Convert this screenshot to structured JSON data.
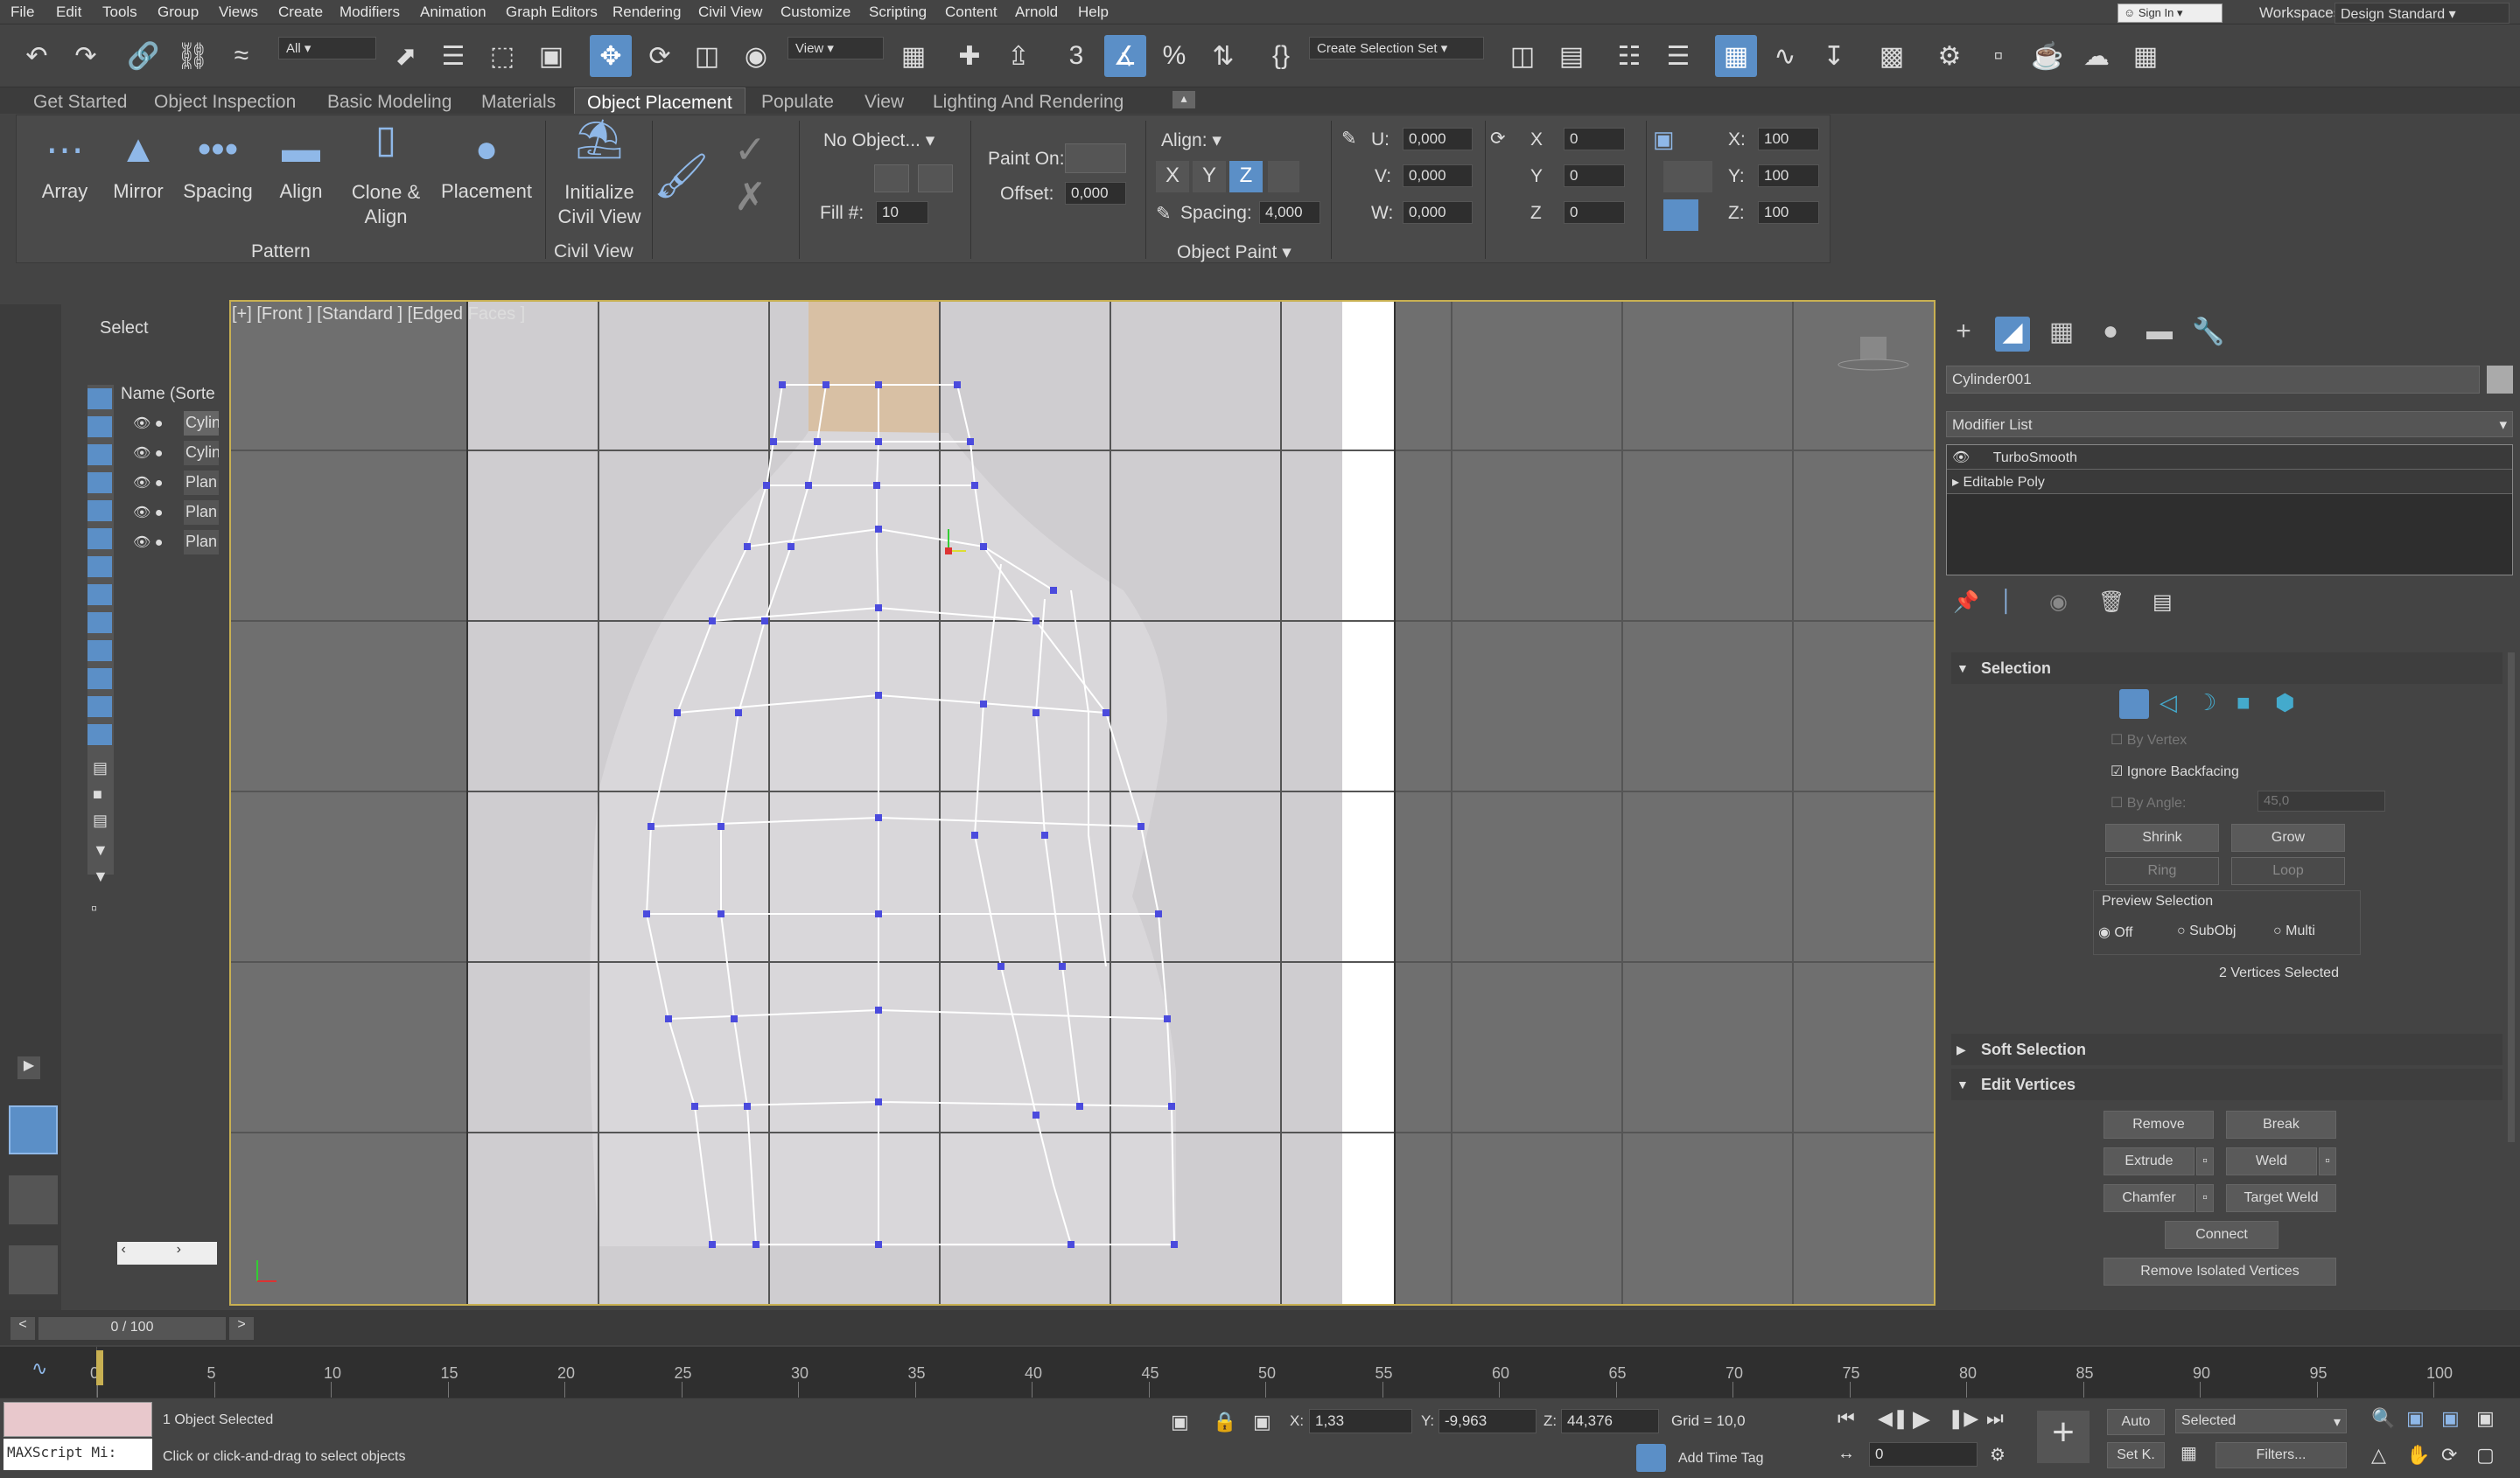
{
  "menu": [
    "File",
    "Edit",
    "Tools",
    "Group",
    "Views",
    "Create",
    "Modifiers",
    "Animation",
    "Graph Editors",
    "Rendering",
    "Civil View",
    "Customize",
    "Scripting",
    "Content",
    "Arnold",
    "Help"
  ],
  "signin": "Sign In",
  "workspaces_label": "Workspaces:",
  "workspace": "Design Standard",
  "toolbar": {
    "filter": "All",
    "ref_coord": "View",
    "selset": "Create Selection Set"
  },
  "tabs": [
    "Get Started",
    "Object Inspection",
    "Basic Modeling",
    "Materials",
    "Object Placement",
    "Populate",
    "View",
    "Lighting And Rendering"
  ],
  "ribbon": {
    "pattern_buttons": [
      "Array",
      "Mirror",
      "Spacing",
      "Align",
      "Clone &\nAlign",
      "Placement"
    ],
    "pattern_label": "Pattern",
    "civil_button": "Initialize\nCivil View",
    "civil_label": "Civil View",
    "no_object": "No Object...",
    "fill_label": "Fill #:",
    "fill_value": "10",
    "paint_on": "Paint On:",
    "offset_label": "Offset:",
    "offset_value": "0,000",
    "align_label": "Align:",
    "spacing_label": "Spacing:",
    "spacing_value": "4,000",
    "axes": [
      "X",
      "Y",
      "Z"
    ],
    "u_label": "U:",
    "u_value": "0,000",
    "v_label": "V:",
    "v_value": "0,000",
    "w_label": "W:",
    "w_value": "0,000",
    "rx_label": "X",
    "rx_value": "0",
    "ry_label": "Y",
    "ry_value": "0",
    "rz_label": "Z",
    "rz_value": "0",
    "sx_label": "X:",
    "sx_value": "100",
    "sy_label": "Y:",
    "sy_value": "100",
    "sz_label": "Z:",
    "sz_value": "100",
    "object_paint_label": "Object Paint"
  },
  "scene": {
    "select": "Select",
    "header": "Name (Sorte",
    "rows": [
      "Cylin",
      "Cylin",
      "Plan",
      "Plan",
      "Plan"
    ]
  },
  "viewport": {
    "label": "[+] [Front ] [Standard ] [Edged Faces ]"
  },
  "cmd": {
    "object_name": "Cylinder001",
    "modifier_list": "Modifier List",
    "stack": [
      "TurboSmooth",
      "Editable Poly"
    ],
    "selection": "Selection",
    "by_vertex": "By Vertex",
    "ignore_backfacing": "Ignore Backfacing",
    "by_angle": "By Angle:",
    "angle_value": "45,0",
    "shrink": "Shrink",
    "grow": "Grow",
    "ring": "Ring",
    "loop": "Loop",
    "preview_selection": "Preview Selection",
    "preview_opts": [
      "Off",
      "SubObj",
      "Multi"
    ],
    "vertices_selected": "2 Vertices Selected",
    "soft_selection": "Soft Selection",
    "edit_vertices": "Edit Vertices",
    "buttons": [
      "Remove",
      "Break",
      "Extrude",
      "Weld",
      "Chamfer",
      "Target Weld",
      "Connect",
      "Remove Isolated Vertices"
    ]
  },
  "time": {
    "frame": "0 / 100",
    "ticks": [
      "0",
      "5",
      "10",
      "15",
      "20",
      "25",
      "30",
      "35",
      "40",
      "45",
      "50",
      "55",
      "60",
      "65",
      "70",
      "75",
      "80",
      "85",
      "90",
      "95",
      "100"
    ]
  },
  "status": {
    "maxscript": "MAXScript Mi:",
    "objects_selected": "1 Object Selected",
    "prompt": "Click or click-and-drag to select objects",
    "x_label": "X:",
    "x_value": "1,33",
    "y_label": "Y:",
    "y_value": "-9,963",
    "z_label": "Z:",
    "z_value": "44,376",
    "grid": "Grid = 10,0",
    "add_time_tag": "Add Time Tag",
    "auto": "Auto",
    "setk": "Set K.",
    "selected": "Selected",
    "filters": "Filters...",
    "current_frame": "0"
  },
  "colors": {
    "accent": "#5b8fc7",
    "vertex": "#4b4bdd",
    "viewport_border": "#c8b052"
  }
}
